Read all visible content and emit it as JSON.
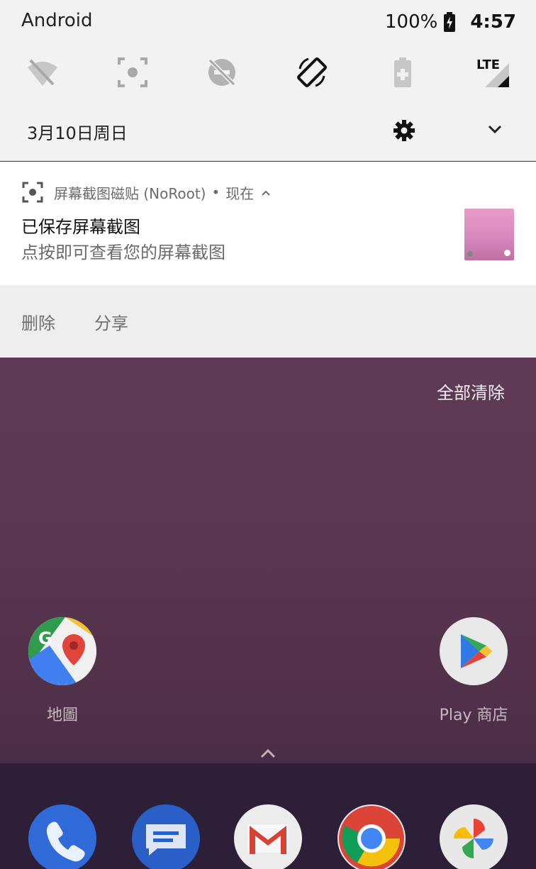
{
  "status_bar": {
    "carrier": "Android",
    "battery": "100%",
    "time": "4:57"
  },
  "quick_settings": {
    "tiles": [
      {
        "name": "wifi-off-icon"
      },
      {
        "name": "screenshot-icon"
      },
      {
        "name": "do-not-disturb-icon"
      },
      {
        "name": "auto-rotate-icon"
      },
      {
        "name": "battery-saver-icon"
      },
      {
        "name": "cellular-lte-icon",
        "label": "LTE"
      }
    ],
    "date": "3月10日周日"
  },
  "notification": {
    "app_name": "屏幕截图磁贴 (NoRoot)",
    "separator": "•",
    "when": "现在",
    "title": "已保存屏幕截图",
    "body": "点按即可查看您的屏幕截图",
    "actions": {
      "delete": "删除",
      "share": "分享"
    }
  },
  "home": {
    "clear_all": "全部清除",
    "apps": {
      "maps": "地圖",
      "play_store": "Play 商店"
    },
    "dock": [
      "phone-icon",
      "messages-icon",
      "gmail-icon",
      "chrome-icon",
      "photos-icon"
    ]
  },
  "colors": {
    "shade_bg": "#f2f2f2",
    "action_bar_bg": "#eeeeee",
    "wallpaper": "#5a3650"
  }
}
